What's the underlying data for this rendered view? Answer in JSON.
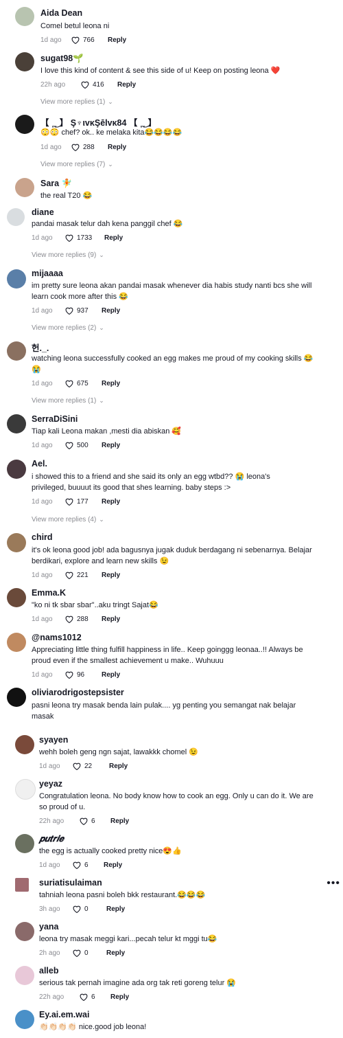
{
  "comments": [
    {
      "name": "Aida Dean",
      "text": "Comel betul leona ni",
      "time": "1d ago",
      "likes": "766",
      "reply": "Reply",
      "avatar_color": "#b8c4b0",
      "nested": true
    },
    {
      "name": "sugat98🌱",
      "text": "I love this kind of content & see this side of u! Keep on posting leona ❤️",
      "time": "22h ago",
      "likes": "416",
      "reply": "Reply",
      "more": "View more replies (1)",
      "avatar_color": "#4a4038",
      "nested": true
    },
    {
      "name": "【 ˳͜˳ 】 Ş♆ιvᴋŞēlvᴋ84 【 ˳͜˳ 】",
      "text": "😳😳 chef? ok.. ke melaka kita😂😂😂😂",
      "time": "1d ago",
      "likes": "288",
      "reply": "Reply",
      "more": "View more replies (7)",
      "avatar_color": "#1a1a1a",
      "nested": true
    },
    {
      "name": "Sara 🧚",
      "text": "the real T20 😂",
      "avatar_color": "#c9a38c",
      "nested": true
    },
    {
      "name": "diane",
      "text": "pandai masak telur dah kena panggil chef 😂",
      "time": "1d ago",
      "likes": "1733",
      "reply": "Reply",
      "more": "View more replies (9)",
      "avatar_color": "#d9dde0"
    },
    {
      "name": "mijaaaa",
      "text": "im pretty sure leona akan pandai masak whenever dia habis study nanti bcs she will learn cook more after this 😂",
      "time": "1d ago",
      "likes": "937",
      "reply": "Reply",
      "more": "View more replies (2)",
      "avatar_color": "#5a7fa8"
    },
    {
      "name": "헌._.",
      "text": "watching leona successfully cooked an egg makes me proud of my cooking skills 😂😭",
      "time": "1d ago",
      "likes": "675",
      "reply": "Reply",
      "more": "View more replies (1)",
      "avatar_color": "#8a7060"
    },
    {
      "name": "SerraDiSini",
      "text": "Tiap kali Leona makan ,mesti dia abiskan 🥰",
      "time": "1d ago",
      "likes": "500",
      "reply": "Reply",
      "avatar_color": "#3a3a3a"
    },
    {
      "name": "Ael.",
      "text": "i showed this to a friend and she said its only an egg wtbd?? 😭 leona's privileged, buuuut its good that shes learning. baby steps :>",
      "time": "1d ago",
      "likes": "177",
      "reply": "Reply",
      "more": "View more replies (4)",
      "avatar_color": "#4a3a40"
    },
    {
      "name": "chird",
      "text": "it's ok leona good job! ada bagusnya jugak duduk berdagang ni sebenarnya. Belajar berdikari, explore and learn new skills 😉",
      "time": "1d ago",
      "likes": "221",
      "reply": "Reply",
      "avatar_color": "#9a7a5a"
    },
    {
      "name": "Emma.K",
      "text": "\"ko ni tk sbar sbar\"..aku tringt Sajat😂",
      "time": "1d ago",
      "likes": "288",
      "reply": "Reply",
      "avatar_color": "#6a4a3a"
    },
    {
      "name": "@nams1012",
      "text": "Appreciating little thing fulfill happiness in life.. Keep goinggg leonaa..!! Always be proud even if the smallest achievement u make.. Wuhuuu",
      "time": "1d ago",
      "likes": "96",
      "reply": "Reply",
      "avatar_color": "#c08a60"
    },
    {
      "name": "oliviarodrigostepsister",
      "text": "pasni leona try masak benda lain pulak.... yg penting you semangat nak belajar masak",
      "avatar_color": "#111111"
    },
    {
      "name": "syayen",
      "text": "wehh boleh geng ngn sajat, lawakkk chomel 😉",
      "time": "1d ago",
      "likes": "22",
      "reply": "Reply",
      "avatar_color": "#7a4a3a"
    },
    {
      "name": "yeyaz",
      "text": "Congratulation leona. No body know how to cook an egg. Only u can do it. We are so proud of u.",
      "time": "22h ago",
      "likes": "6",
      "reply": "Reply",
      "avatar_color": "#f0f0f0"
    },
    {
      "name": "𝒑𝒖𝒕𝒓𝒊𝒆",
      "text": "the egg is actually cooked pretty nice😍👍",
      "time": "1d ago",
      "likes": "6",
      "reply": "Reply",
      "avatar_color": "#6a7060"
    },
    {
      "name": "suriatisulaiman",
      "text": "tahniah leona pasni boleh bkk restaurant.😂😂😂",
      "time": "3h ago",
      "likes": "0",
      "reply": "Reply",
      "avatar_color": "#a06a70"
    },
    {
      "name": "yana",
      "text": "leona try masak meggi kari...pecah telur kt mggi tu😂",
      "time": "2h ago",
      "likes": "0",
      "reply": "Reply",
      "avatar_color": "#8a6a6a"
    },
    {
      "name": "alleb",
      "text": "serious tak pernah imagine ada org tak reti goreng telur 😭",
      "time": "22h ago",
      "likes": "6",
      "reply": "Reply",
      "avatar_color": "#e8c8d8"
    },
    {
      "name": "Ey.ai.em.wai",
      "text": "👏🏻👏🏻👏🏻👏🏻 nice.good job leona!",
      "avatar_color": "#4a90c8"
    }
  ],
  "more_options": "•••"
}
